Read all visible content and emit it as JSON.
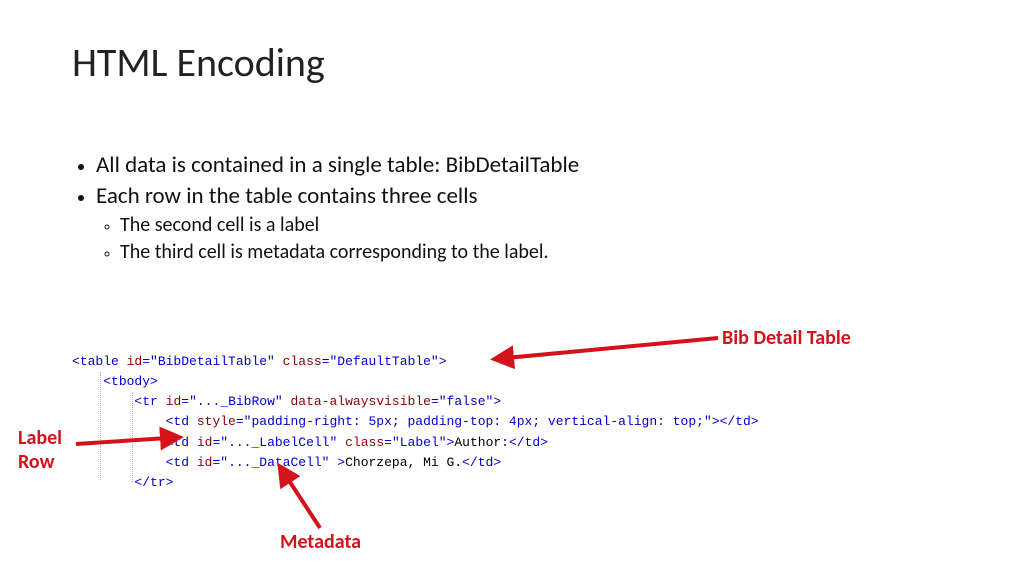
{
  "title": "HTML Encoding",
  "bullets": {
    "b1": "All data is contained in a single table: BibDetailTable",
    "b2": "Each row in the table contains three cells",
    "b2a": "The second cell is a label",
    "b2b": "The third cell is metadata corresponding to the label."
  },
  "code": {
    "line1": {
      "open": "<table ",
      "attr1n": "id",
      "attr1v": "\"BibDetailTable\"",
      "attr2n": "class",
      "attr2v": "\"DefaultTable\"",
      "close": ">"
    },
    "line2": "<tbody>",
    "line3": {
      "open": "<tr ",
      "attr1n": "id",
      "attr1v": "\"..._BibRow\"",
      "attr2n": "data-alwaysvisible",
      "attr2v": "\"false\"",
      "close": ">"
    },
    "line4": {
      "open": "<td ",
      "attr1n": "style",
      "attr1v": "\"padding-right: 5px; padding-top: 4px; vertical-align: top;\"",
      "mid": ">",
      "end": "</td>"
    },
    "line5": {
      "open": "<td ",
      "attr1n": "id",
      "attr1v": "\"..._LabelCell\"",
      "attr2n": "class",
      "attr2v": "\"Label\"",
      "mid": ">",
      "text": "Author:",
      "end": "</td>"
    },
    "line6": {
      "open": "<td ",
      "attr1n": "id",
      "attr1v": "\"..._DataCell\"",
      "mid": " >",
      "text": "Chorzepa, Mi G.",
      "end": "</td>"
    },
    "line7": "</tr>"
  },
  "callouts": {
    "bibtable": "Bib Detail Table",
    "labelrow1": "Label",
    "labelrow2": "Row",
    "metadata": "Metadata"
  }
}
